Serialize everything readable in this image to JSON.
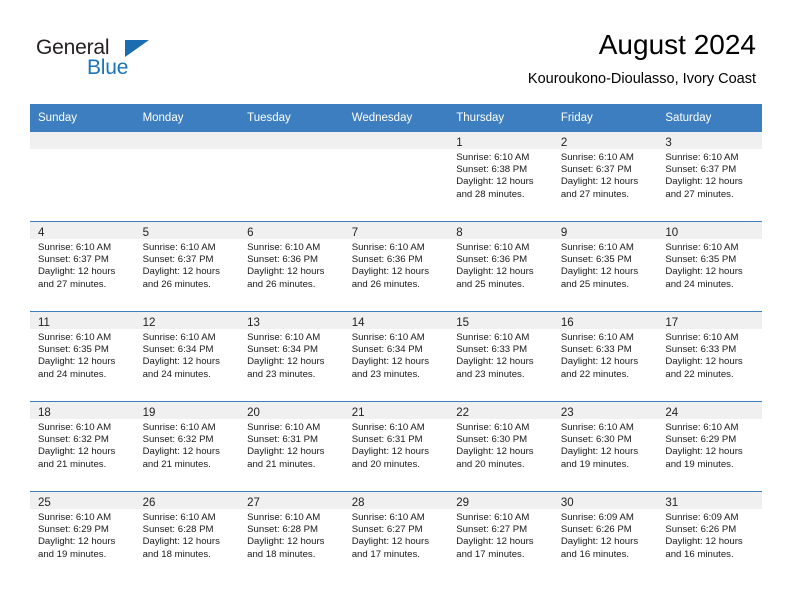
{
  "brand": {
    "name_dark": "General",
    "name_light": "Blue"
  },
  "header": {
    "month_title": "August 2024",
    "location": "Kouroukono-Dioulasso, Ivory Coast"
  },
  "colors": {
    "header_bar": "#3c7ebf",
    "brand_blue": "#1b75bb",
    "daynum_band": "#f0f0f0"
  },
  "weekday_headers": [
    "Sunday",
    "Monday",
    "Tuesday",
    "Wednesday",
    "Thursday",
    "Friday",
    "Saturday"
  ],
  "weeks": [
    [
      {
        "day": "",
        "lines": []
      },
      {
        "day": "",
        "lines": []
      },
      {
        "day": "",
        "lines": []
      },
      {
        "day": "",
        "lines": []
      },
      {
        "day": "1",
        "lines": [
          "Sunrise: 6:10 AM",
          "Sunset: 6:38 PM",
          "Daylight: 12 hours",
          "and 28 minutes."
        ]
      },
      {
        "day": "2",
        "lines": [
          "Sunrise: 6:10 AM",
          "Sunset: 6:37 PM",
          "Daylight: 12 hours",
          "and 27 minutes."
        ]
      },
      {
        "day": "3",
        "lines": [
          "Sunrise: 6:10 AM",
          "Sunset: 6:37 PM",
          "Daylight: 12 hours",
          "and 27 minutes."
        ]
      }
    ],
    [
      {
        "day": "4",
        "lines": [
          "Sunrise: 6:10 AM",
          "Sunset: 6:37 PM",
          "Daylight: 12 hours",
          "and 27 minutes."
        ]
      },
      {
        "day": "5",
        "lines": [
          "Sunrise: 6:10 AM",
          "Sunset: 6:37 PM",
          "Daylight: 12 hours",
          "and 26 minutes."
        ]
      },
      {
        "day": "6",
        "lines": [
          "Sunrise: 6:10 AM",
          "Sunset: 6:36 PM",
          "Daylight: 12 hours",
          "and 26 minutes."
        ]
      },
      {
        "day": "7",
        "lines": [
          "Sunrise: 6:10 AM",
          "Sunset: 6:36 PM",
          "Daylight: 12 hours",
          "and 26 minutes."
        ]
      },
      {
        "day": "8",
        "lines": [
          "Sunrise: 6:10 AM",
          "Sunset: 6:36 PM",
          "Daylight: 12 hours",
          "and 25 minutes."
        ]
      },
      {
        "day": "9",
        "lines": [
          "Sunrise: 6:10 AM",
          "Sunset: 6:35 PM",
          "Daylight: 12 hours",
          "and 25 minutes."
        ]
      },
      {
        "day": "10",
        "lines": [
          "Sunrise: 6:10 AM",
          "Sunset: 6:35 PM",
          "Daylight: 12 hours",
          "and 24 minutes."
        ]
      }
    ],
    [
      {
        "day": "11",
        "lines": [
          "Sunrise: 6:10 AM",
          "Sunset: 6:35 PM",
          "Daylight: 12 hours",
          "and 24 minutes."
        ]
      },
      {
        "day": "12",
        "lines": [
          "Sunrise: 6:10 AM",
          "Sunset: 6:34 PM",
          "Daylight: 12 hours",
          "and 24 minutes."
        ]
      },
      {
        "day": "13",
        "lines": [
          "Sunrise: 6:10 AM",
          "Sunset: 6:34 PM",
          "Daylight: 12 hours",
          "and 23 minutes."
        ]
      },
      {
        "day": "14",
        "lines": [
          "Sunrise: 6:10 AM",
          "Sunset: 6:34 PM",
          "Daylight: 12 hours",
          "and 23 minutes."
        ]
      },
      {
        "day": "15",
        "lines": [
          "Sunrise: 6:10 AM",
          "Sunset: 6:33 PM",
          "Daylight: 12 hours",
          "and 23 minutes."
        ]
      },
      {
        "day": "16",
        "lines": [
          "Sunrise: 6:10 AM",
          "Sunset: 6:33 PM",
          "Daylight: 12 hours",
          "and 22 minutes."
        ]
      },
      {
        "day": "17",
        "lines": [
          "Sunrise: 6:10 AM",
          "Sunset: 6:33 PM",
          "Daylight: 12 hours",
          "and 22 minutes."
        ]
      }
    ],
    [
      {
        "day": "18",
        "lines": [
          "Sunrise: 6:10 AM",
          "Sunset: 6:32 PM",
          "Daylight: 12 hours",
          "and 21 minutes."
        ]
      },
      {
        "day": "19",
        "lines": [
          "Sunrise: 6:10 AM",
          "Sunset: 6:32 PM",
          "Daylight: 12 hours",
          "and 21 minutes."
        ]
      },
      {
        "day": "20",
        "lines": [
          "Sunrise: 6:10 AM",
          "Sunset: 6:31 PM",
          "Daylight: 12 hours",
          "and 21 minutes."
        ]
      },
      {
        "day": "21",
        "lines": [
          "Sunrise: 6:10 AM",
          "Sunset: 6:31 PM",
          "Daylight: 12 hours",
          "and 20 minutes."
        ]
      },
      {
        "day": "22",
        "lines": [
          "Sunrise: 6:10 AM",
          "Sunset: 6:30 PM",
          "Daylight: 12 hours",
          "and 20 minutes."
        ]
      },
      {
        "day": "23",
        "lines": [
          "Sunrise: 6:10 AM",
          "Sunset: 6:30 PM",
          "Daylight: 12 hours",
          "and 19 minutes."
        ]
      },
      {
        "day": "24",
        "lines": [
          "Sunrise: 6:10 AM",
          "Sunset: 6:29 PM",
          "Daylight: 12 hours",
          "and 19 minutes."
        ]
      }
    ],
    [
      {
        "day": "25",
        "lines": [
          "Sunrise: 6:10 AM",
          "Sunset: 6:29 PM",
          "Daylight: 12 hours",
          "and 19 minutes."
        ]
      },
      {
        "day": "26",
        "lines": [
          "Sunrise: 6:10 AM",
          "Sunset: 6:28 PM",
          "Daylight: 12 hours",
          "and 18 minutes."
        ]
      },
      {
        "day": "27",
        "lines": [
          "Sunrise: 6:10 AM",
          "Sunset: 6:28 PM",
          "Daylight: 12 hours",
          "and 18 minutes."
        ]
      },
      {
        "day": "28",
        "lines": [
          "Sunrise: 6:10 AM",
          "Sunset: 6:27 PM",
          "Daylight: 12 hours",
          "and 17 minutes."
        ]
      },
      {
        "day": "29",
        "lines": [
          "Sunrise: 6:10 AM",
          "Sunset: 6:27 PM",
          "Daylight: 12 hours",
          "and 17 minutes."
        ]
      },
      {
        "day": "30",
        "lines": [
          "Sunrise: 6:09 AM",
          "Sunset: 6:26 PM",
          "Daylight: 12 hours",
          "and 16 minutes."
        ]
      },
      {
        "day": "31",
        "lines": [
          "Sunrise: 6:09 AM",
          "Sunset: 6:26 PM",
          "Daylight: 12 hours",
          "and 16 minutes."
        ]
      }
    ]
  ]
}
